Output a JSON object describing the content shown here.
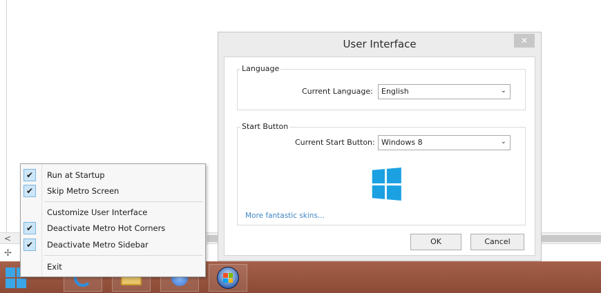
{
  "dialog": {
    "title": "User Interface",
    "close_glyph": "✕",
    "language_group": {
      "legend": "Language",
      "label": "Current Language:",
      "value": "English"
    },
    "start_button_group": {
      "legend": "Start Button",
      "label": "Current Start Button:",
      "value": "Windows 8",
      "link": "More fantastic skins..."
    },
    "ok_label": "OK",
    "cancel_label": "Cancel"
  },
  "context_menu": {
    "items": [
      {
        "label": "Run at Startup",
        "checked": true
      },
      {
        "label": "Skip Metro Screen",
        "checked": true
      },
      {
        "label": "Customize User Interface",
        "checked": false
      },
      {
        "label": "Deactivate Metro Hot Corners",
        "checked": true
      },
      {
        "label": "Deactivate Metro Sidebar",
        "checked": true
      },
      {
        "label": "Exit",
        "checked": false
      }
    ],
    "check_glyph": "✔"
  },
  "glyphs": {
    "chevron": "⌄",
    "scroll_left": "<",
    "move_handle": "✢"
  },
  "colors": {
    "taskbar": "#9a563f",
    "accent": "#1ba1e2",
    "link": "#3f86c6"
  },
  "icons": {
    "start": "windows-logo-icon",
    "taskbar": [
      "internet-explorer-icon",
      "file-explorer-icon",
      "media-player-icon",
      "windows7-orb-icon"
    ]
  }
}
